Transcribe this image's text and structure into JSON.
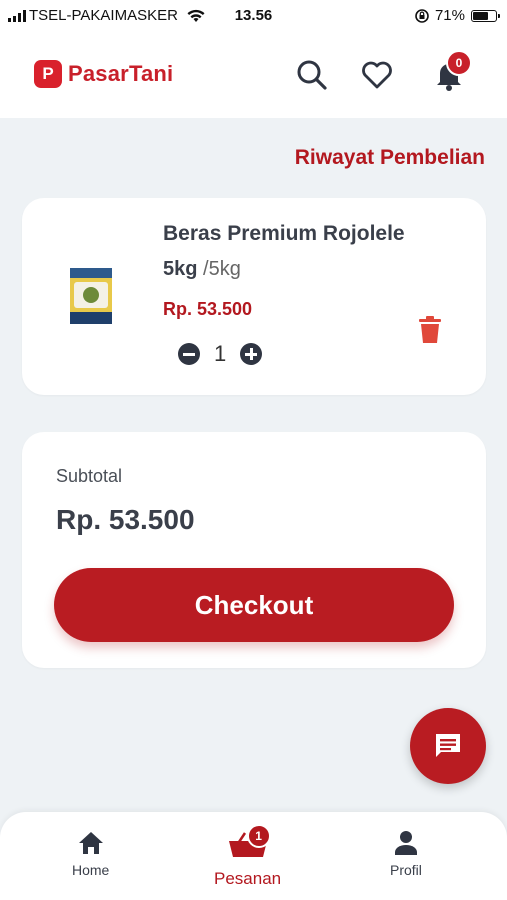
{
  "status": {
    "carrier": "TSEL-PAKAIMASKER",
    "time": "13.56",
    "battery": "71%",
    "battery_level": 0.71
  },
  "header": {
    "logo_letter": "P",
    "app_name": "PasarTani",
    "notification_count": "0"
  },
  "history_link": "Riwayat Pembelian",
  "cart": {
    "items": [
      {
        "name": "Beras Premium Rojolele",
        "weight": "5kg",
        "unit": "/5kg",
        "price": "Rp. 53.500",
        "quantity": "1"
      }
    ]
  },
  "summary": {
    "subtotal_label": "Subtotal",
    "subtotal_value": "Rp. 53.500",
    "checkout_label": "Checkout"
  },
  "nav": {
    "home": "Home",
    "orders": "Pesanan",
    "orders_badge": "1",
    "profile": "Profil"
  },
  "colors": {
    "brand": "#b91c22",
    "accent": "#d9212c",
    "background": "#eef2f5"
  }
}
